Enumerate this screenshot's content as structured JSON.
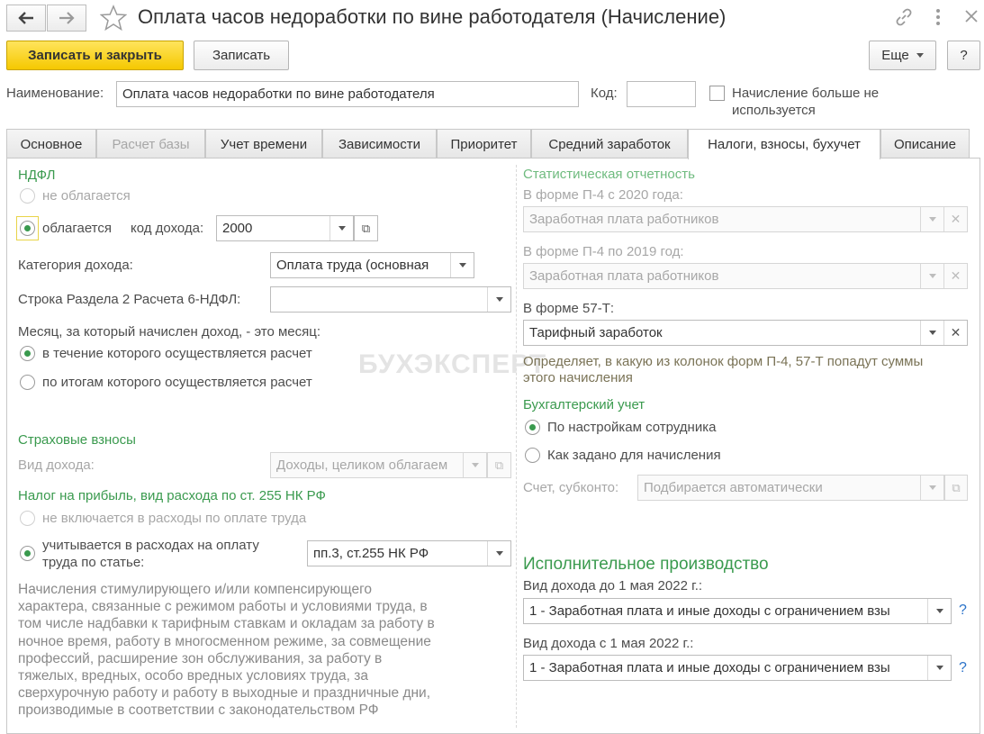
{
  "window": {
    "title": "Оплата часов недоработки по вине работодателя (Начисление)"
  },
  "toolbar": {
    "save_close_label": "Записать и закрыть",
    "save_label": "Записать",
    "more_label": "Еще",
    "help_label": "?"
  },
  "header": {
    "name_label": "Наименование:",
    "name_value": "Оплата часов недоработки по вине работодателя",
    "code_label": "Код:",
    "code_value": "",
    "not_used_label_line1": "Начисление больше не",
    "not_used_label_line2": "используется",
    "not_used_checked": false
  },
  "tabs": [
    {
      "label": "Основное"
    },
    {
      "label": "Расчет базы"
    },
    {
      "label": "Учет времени"
    },
    {
      "label": "Зависимости"
    },
    {
      "label": "Приоритет"
    },
    {
      "label": "Средний заработок"
    },
    {
      "label": "Налоги, взносы, бухучет"
    },
    {
      "label": "Описание"
    }
  ],
  "active_tab": "Налоги, взносы, бухучет",
  "ndfl": {
    "heading": "НДФЛ",
    "not_taxed_label": "не облагается",
    "taxed_label": "облагается",
    "income_code_label": "код дохода:",
    "income_code_value": "2000",
    "income_category_label": "Категория дохода:",
    "income_category_value": "Оплата труда (основная",
    "section2_label": "Строка Раздела 2 Расчета 6-НДФЛ:",
    "section2_value": "",
    "month_question": "Месяц, за который начислен доход, - это месяц:",
    "month_option1": "в течение которого осуществляется расчет",
    "month_option2": "по итогам которого осуществляется расчет"
  },
  "insurance": {
    "heading": "Страховые взносы",
    "income_type_label": "Вид дохода:",
    "income_type_value": "Доходы, целиком облагаем"
  },
  "profit_tax": {
    "heading": "Налог на прибыль, вид расхода по ст. 255 НК РФ",
    "option1": "не включается в расходы по оплате труда",
    "option2_line1": "учитывается в расходах на оплату",
    "option2_line2": "труда по статье:",
    "article_value": "пп.3, ст.255 НК РФ",
    "note_lines": [
      "Начисления стимулирующего и/или компенсирующего",
      "характера, связанные с режимом работы и условиями труда, в",
      "том числе надбавки к тарифным ставкам и окладам за работу в",
      "ночное время, работу в многосменном режиме, за совмещение",
      "профессий, расширение зон обслуживания, за работу в",
      "тяжелых, вредных, особо вредных условиях труда, за",
      "сверхурочную работу и работу в выходные и праздничные дни,",
      "производимые в соответствии с законодательством РФ"
    ]
  },
  "statistics": {
    "heading": "Статистическая отчетность",
    "p4_2020_label": "В форме П-4 с 2020 года:",
    "p4_2020_value": "Заработная плата работников",
    "p4_2019_label": "В форме П-4 по 2019 год:",
    "p4_2019_value": "Заработная плата работников",
    "f57t_label": "В форме 57-Т:",
    "f57t_value": "Тарифный заработок",
    "hint_line1": "Определяет, в какую из колонок форм П-4, 57-Т попадут суммы",
    "hint_line2": "этого начисления"
  },
  "accounting": {
    "heading": "Бухгалтерский учет",
    "option1": "По настройкам сотрудника",
    "option2": "Как задано для начисления",
    "account_label": "Счет, субконто:",
    "account_placeholder": "Подбирается автоматически"
  },
  "enforcement": {
    "heading": "Исполнительное производство",
    "before_label": "Вид дохода до 1 мая 2022 г.:",
    "before_value": "1 - Заработная плата и иные доходы с ограничением взы",
    "after_label": "Вид дохода с 1 мая 2022 г.:",
    "after_value": "1 - Заработная плата и иные доходы с ограничением взы",
    "help_mark": "?"
  },
  "watermark": "БУХЭКСПЕРТ"
}
